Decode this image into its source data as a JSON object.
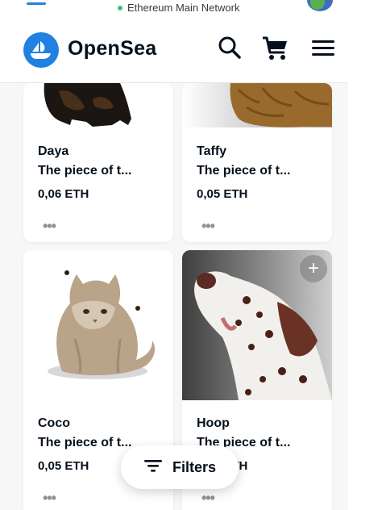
{
  "status_bar": {
    "network": "Ethereum Main Network"
  },
  "header": {
    "brand": "OpenSea",
    "logo_color": "#2081e2",
    "icons": [
      "search-icon",
      "cart-icon",
      "hamburger-menu-icon"
    ]
  },
  "cards": [
    {
      "name": "Daya",
      "description": "The piece of t...",
      "price": "0,06 ETH",
      "more": "•••"
    },
    {
      "name": "Taffy",
      "description": "The piece of t...",
      "price": "0,05 ETH",
      "more": "•••"
    },
    {
      "name": "Coco",
      "description": "The piece of t...",
      "price": "0,05 ETH",
      "more": "•••"
    },
    {
      "name": "Hoop",
      "description": "The piece of t...",
      "price": "0,05 ETH",
      "more": "•••",
      "action": "+"
    }
  ],
  "filters": {
    "label": "Filters"
  }
}
